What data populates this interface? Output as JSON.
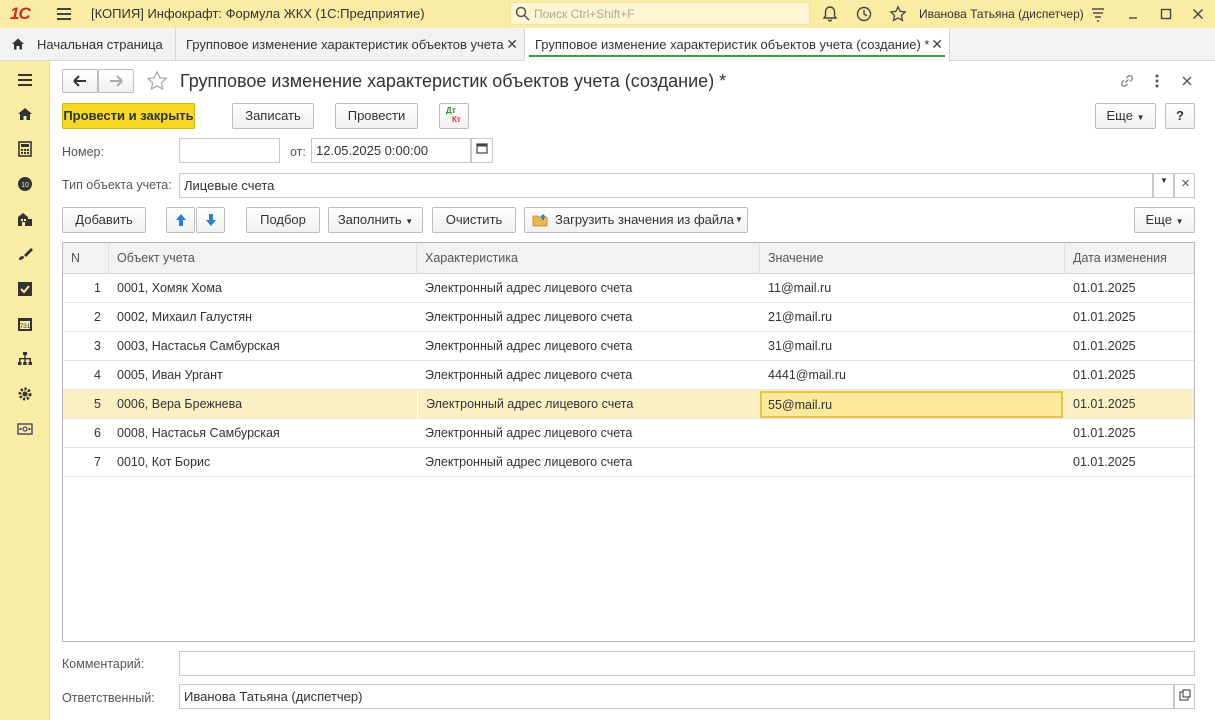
{
  "window": {
    "logo": "1С",
    "title": "[КОПИЯ] Инфокрафт: Формула ЖКХ  (1С:Предприятие)",
    "search_placeholder": "Поиск Ctrl+Shift+F",
    "user": "Иванова Татьяна (диспетчер)"
  },
  "tabs": [
    {
      "label": "Начальная страница",
      "icon": "home-icon"
    },
    {
      "label": "Групповое изменение характеристик объектов учета"
    },
    {
      "label": "Групповое изменение характеристик объектов учета (создание) *"
    }
  ],
  "nav_icons": [
    "menu-icon",
    "home-icon",
    "calculator-icon",
    "counter-icon",
    "building-icon",
    "brush-icon",
    "checkbox-icon",
    "calendar-icon",
    "org-structure-icon",
    "settings-icon",
    "cash-icon"
  ],
  "document": {
    "title": "Групповое изменение характеристик объектов учета (создание) *"
  },
  "toolbar": {
    "post_close": "Провести и закрыть",
    "save": "Записать",
    "post": "Провести",
    "dtkt_dt": "Дт",
    "dtkt_kt": "Кт",
    "more": "Еще",
    "help": "?"
  },
  "header": {
    "number_label": "Номер:",
    "number_value": "",
    "date_label": "от:",
    "date_value": "12.05.2025  0:00:00",
    "object_type_label": "Тип объекта учета:",
    "object_type_value": "Лицевые счета"
  },
  "table_toolbar": {
    "add": "Добавить",
    "pick": "Подбор",
    "fill": "Заполнить",
    "clear": "Очистить",
    "load": "Загрузить значения из файла",
    "more": "Еще"
  },
  "table": {
    "columns": [
      "N",
      "Объект учета",
      "Характеристика",
      "Значение",
      "Дата изменения"
    ],
    "rows": [
      {
        "n": "1",
        "object": "0001, Хомяк Хома",
        "characteristic": "Электронный адрес лицевого счета",
        "value": "11@mail.ru",
        "date": "01.01.2025"
      },
      {
        "n": "2",
        "object": "0002, Михаил Галустян",
        "characteristic": "Электронный адрес лицевого счета",
        "value": "21@mail.ru",
        "date": "01.01.2025"
      },
      {
        "n": "3",
        "object": "0003, Настасья Самбурская",
        "characteristic": "Электронный адрес лицевого счета",
        "value": "31@mail.ru",
        "date": "01.01.2025"
      },
      {
        "n": "4",
        "object": "0005, Иван Ургант",
        "characteristic": "Электронный адрес лицевого счета",
        "value": "4441@mail.ru",
        "date": "01.01.2025"
      },
      {
        "n": "5",
        "object": "0006, Вера Брежнева",
        "characteristic": "Электронный адрес лицевого счета",
        "value": "55@mail.ru",
        "date": "01.01.2025"
      },
      {
        "n": "6",
        "object": "0008, Настасья Самбурская",
        "characteristic": "Электронный адрес лицевого счета",
        "value": "",
        "date": "01.01.2025"
      },
      {
        "n": "7",
        "object": "0010, Кот Борис",
        "characteristic": "Электронный адрес лицевого счета",
        "value": "",
        "date": "01.01.2025"
      }
    ]
  },
  "footer": {
    "comment_label": "Комментарий:",
    "comment_value": "",
    "responsible_label": "Ответственный:",
    "responsible_value": "Иванова Татьяна (диспетчер)"
  },
  "colors": {
    "accent_yellow": "#fbeca4",
    "primary_button": "#f5d725",
    "active_tab_line": "#3a9c3a",
    "selected_row": "#fbf0c4"
  }
}
